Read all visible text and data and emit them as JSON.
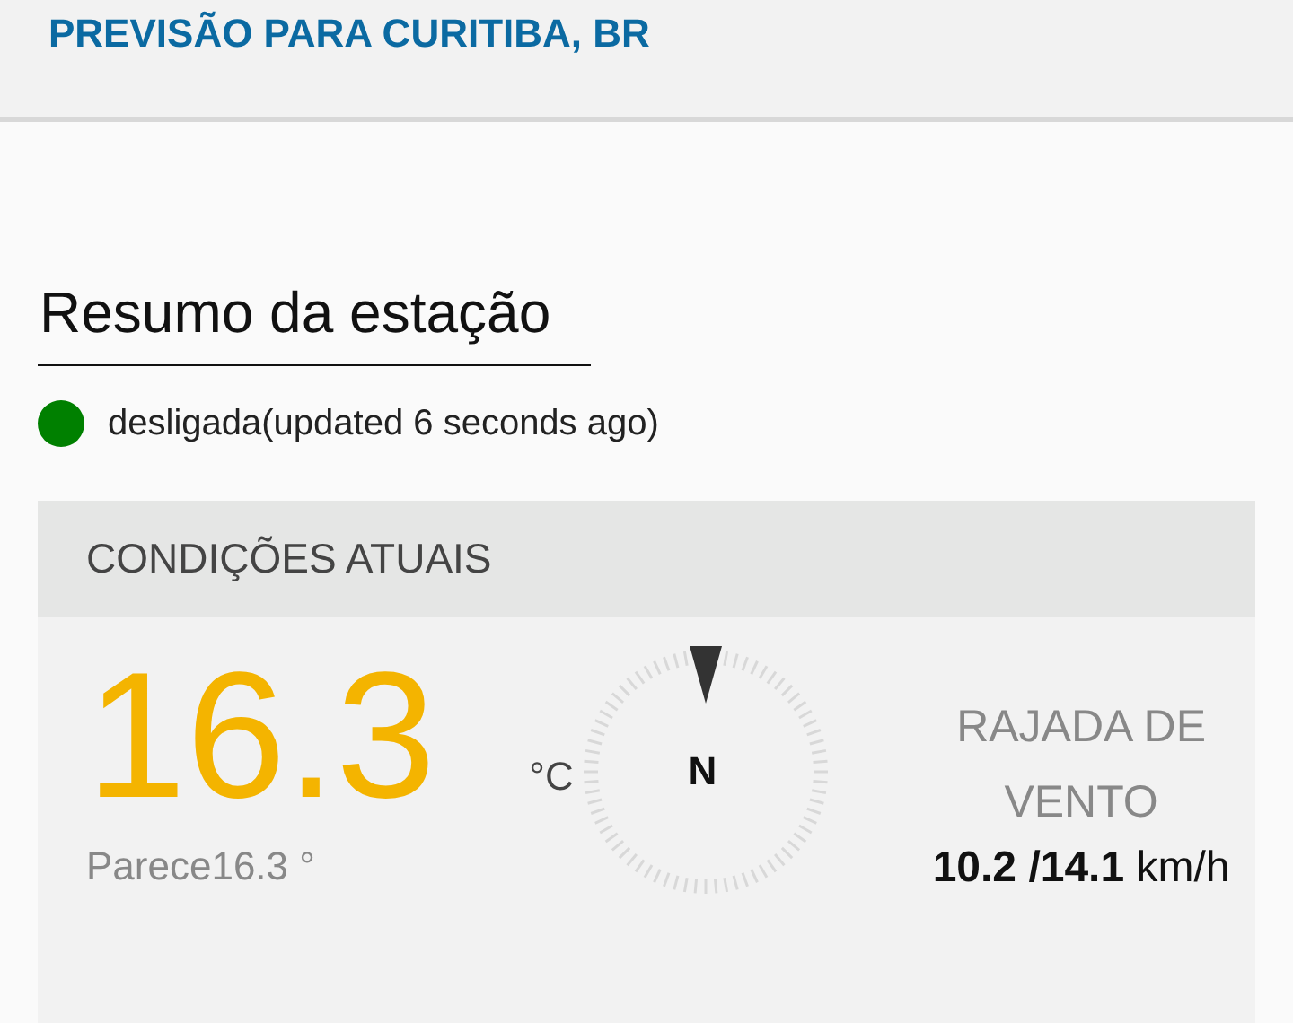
{
  "header": {
    "title": "PREVISÃO PARA CURITIBA, BR"
  },
  "summary": {
    "title": "Resumo da estação",
    "status": {
      "color": "#008000",
      "text": "desligada(updated 6 seconds ago)"
    }
  },
  "card": {
    "title": "CONDIÇÕES ATUAIS",
    "temperature": "16.3",
    "unit": "°C",
    "feels_like": "Parece16.3 °",
    "compass_label": "N",
    "wind_title": "RAJADA DE VENTO",
    "wind_value": "**10.2 /14.1** km/h"
  }
}
